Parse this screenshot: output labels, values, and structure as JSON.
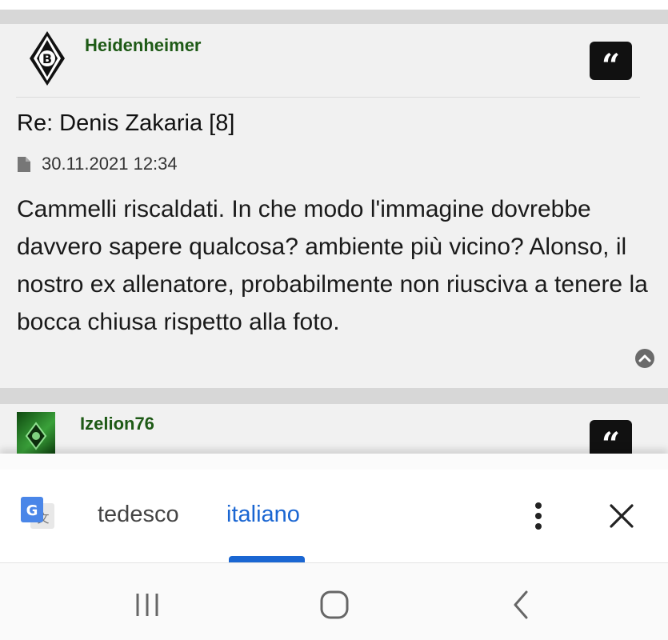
{
  "post1": {
    "username": "Heidenheimer",
    "quote_glyph": "“",
    "title": "Re: Denis Zakaria [8]",
    "date": "30.11.2021 12:34",
    "body": "Cammelli riscaldati. In che modo l'immagine dovrebbe davvero sapere qualcosa? ambiente più vicino? Alonso, il nostro ex allenatore, probabilmente non riusciva a tenere la bocca chiusa rispetto alla foto.",
    "avatar_letter": "B"
  },
  "post2": {
    "username": "Izelion76",
    "quote_glyph": "“"
  },
  "translate_bar": {
    "source_lang": "tedesco",
    "target_lang": "italiano",
    "active_color": "#1a66d2"
  },
  "colors": {
    "username": "#1e5a16",
    "separator": "#d7d7d7",
    "background": "#f1f1f1"
  },
  "icons": [
    "document-icon",
    "chevron-up-circle-icon",
    "google-translate-icon",
    "more-vert-icon",
    "close-icon",
    "recents-icon",
    "home-icon",
    "back-icon"
  ]
}
